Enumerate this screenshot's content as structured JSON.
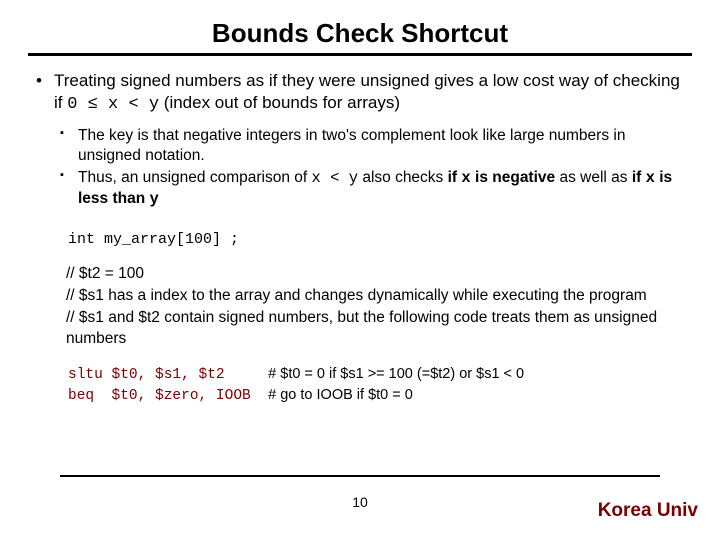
{
  "title": "Bounds Check Shortcut",
  "bullet1_a": "Treating signed numbers as if they were unsigned gives a low cost way of checking if ",
  "bullet1_code": "0 ≤ x < y",
  "bullet1_b": " (index out of bounds for arrays)",
  "sub1": "The key is that negative integers in two's complement look like large numbers in unsigned notation.",
  "sub2_a": "Thus, an unsigned comparison of ",
  "sub2_code1": "x < y",
  "sub2_b": " also checks ",
  "sub2_bold1": "if ",
  "sub2_code2": "x",
  "sub2_bold2": " is negative",
  "sub2_c": " as well as ",
  "sub2_bold3": "if ",
  "sub2_code3": "x",
  "sub2_bold4": " is less than ",
  "sub2_code4": "y",
  "decl": "int   my_array[100] ;",
  "c1a": "// $t2 = 100",
  "c2a": "// $s1 has a index to the array and changes dynamically while executing the program",
  "c3a": "// $s1 and $t2 contain signed numbers, but the following code treats them as unsigned numbers",
  "asm1": "sltu $t0, $s1, $t2",
  "asm1c": "# $t0 = 0 if $s1 >= 100 (=$t2) or $s1 < 0",
  "asm2": "beq  $t0, $zero, IOOB",
  "asm2c": "# go to IOOB if $t0 = 0",
  "page": "10",
  "brand": "Korea Univ"
}
